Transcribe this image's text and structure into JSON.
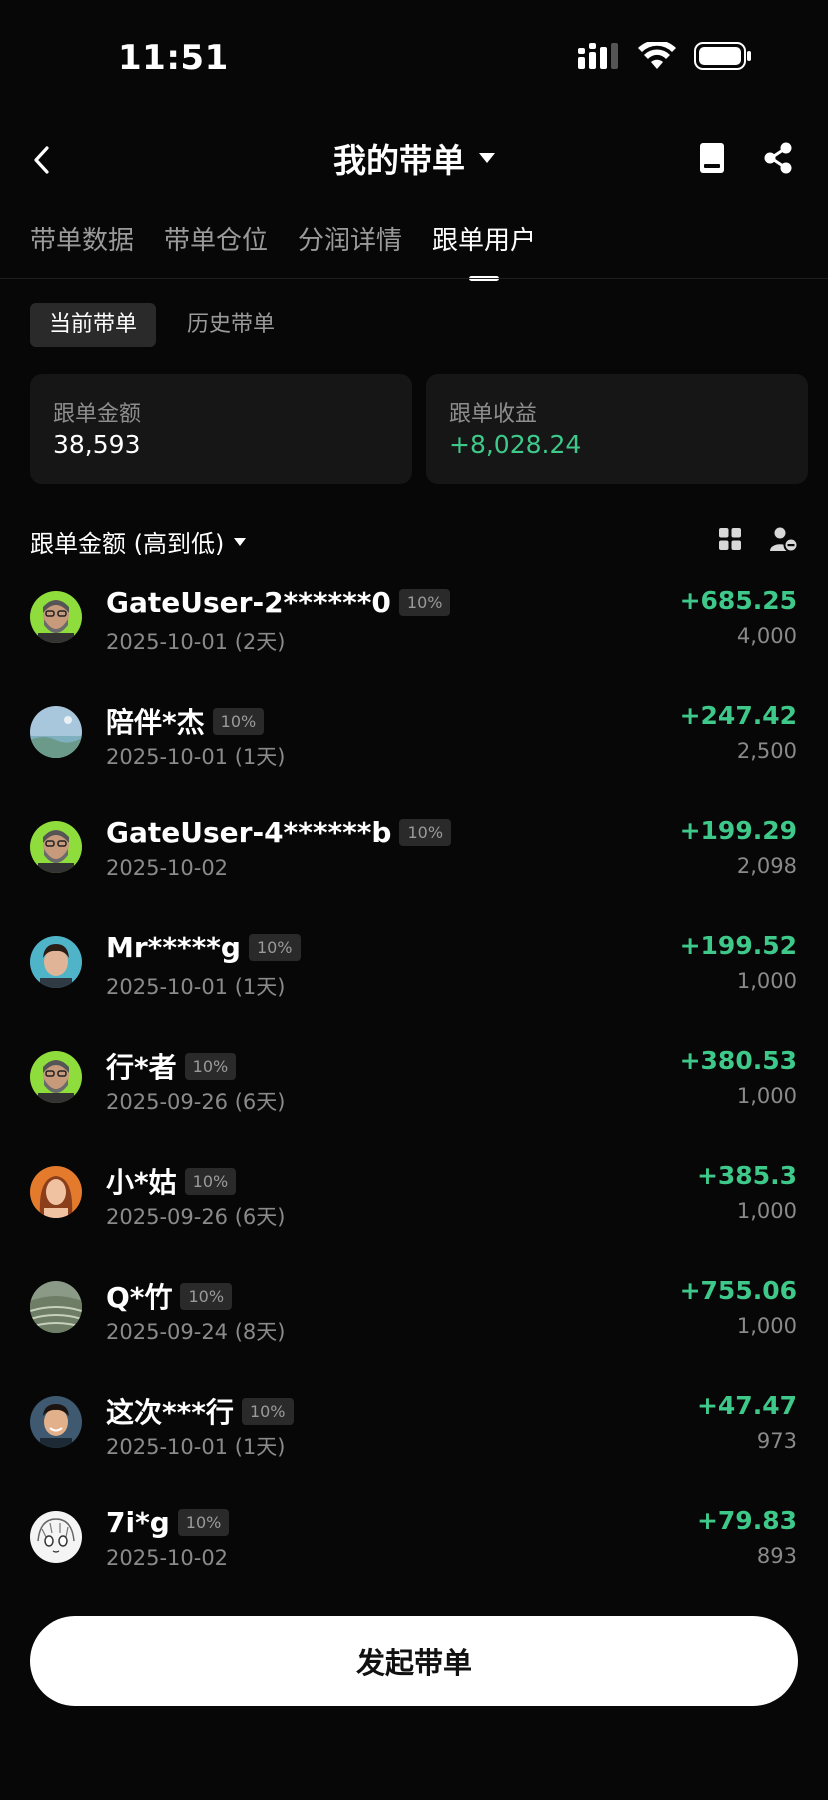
{
  "status_bar": {
    "time": "11:51"
  },
  "header": {
    "title": "我的带单"
  },
  "tabs": [
    {
      "label": "带单数据"
    },
    {
      "label": "带单仓位"
    },
    {
      "label": "分润详情"
    },
    {
      "label": "跟单用户",
      "active": true
    }
  ],
  "segments": [
    {
      "label": "当前带单",
      "active": true
    },
    {
      "label": "历史带单"
    }
  ],
  "stats": {
    "amount_label": "跟单金额",
    "amount_value": "38,593",
    "profit_label": "跟单收益",
    "profit_value": "+8,028.24"
  },
  "sort": {
    "label": "跟单金额 (高到低)"
  },
  "followers": [
    {
      "name": "GateUser-2******0",
      "badge": "10%",
      "date": "2025-10-01 (2天)",
      "profit": "+685.25",
      "amount": "4,000",
      "avatar": "bearded-man"
    },
    {
      "name": "陪伴*杰",
      "badge": "10%",
      "date": "2025-10-01 (1天)",
      "profit": "+247.42",
      "amount": "2,500",
      "avatar": "landscape"
    },
    {
      "name": "GateUser-4******b",
      "badge": "10%",
      "date": "2025-10-02",
      "profit": "+199.29",
      "amount": "2,098",
      "avatar": "bearded-man"
    },
    {
      "name": "Mr*****g",
      "badge": "10%",
      "date": "2025-10-01 (1天)",
      "profit": "+199.52",
      "amount": "1,000",
      "avatar": "young-man"
    },
    {
      "name": "行*者",
      "badge": "10%",
      "date": "2025-09-26 (6天)",
      "profit": "+380.53",
      "amount": "1,000",
      "avatar": "bearded-man"
    },
    {
      "name": "小*姑",
      "badge": "10%",
      "date": "2025-09-26 (6天)",
      "profit": "+385.3",
      "amount": "1,000",
      "avatar": "woman"
    },
    {
      "name": "Q*竹",
      "badge": "10%",
      "date": "2025-09-24 (8天)",
      "profit": "+755.06",
      "amount": "1,000",
      "avatar": "terrace"
    },
    {
      "name": "这次***行",
      "badge": "10%",
      "date": "2025-10-01 (1天)",
      "profit": "+47.47",
      "amount": "973",
      "avatar": "smiling-man"
    },
    {
      "name": "7i*g",
      "badge": "10%",
      "date": "2025-10-02",
      "profit": "+79.83",
      "amount": "893",
      "avatar": "anime-sketch"
    }
  ],
  "cta": {
    "label": "发起带单"
  },
  "colors": {
    "background": "#070707",
    "profit_green": "#3ec98a",
    "card": "#161616"
  }
}
